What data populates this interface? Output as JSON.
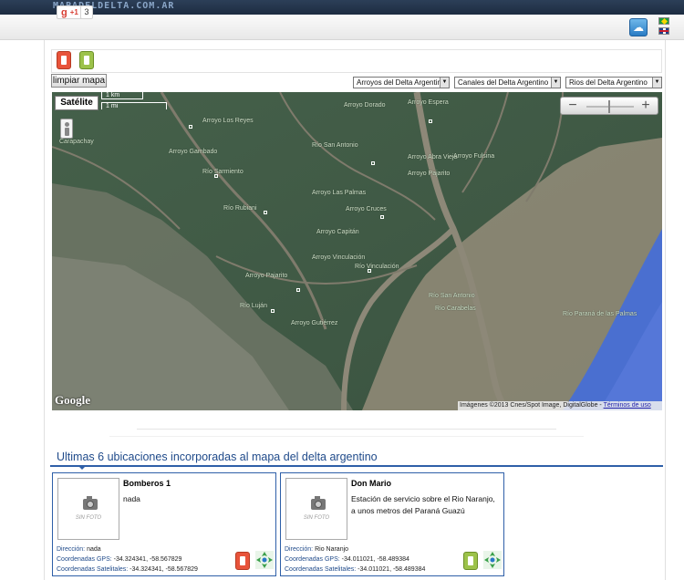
{
  "site": {
    "logo_text": "MAPADELDELTA.COM.AR"
  },
  "social": {
    "gplus_label": "+1",
    "gplus_g": "g",
    "gplus_count": "3"
  },
  "controls": {
    "clear_button": "limpiar mapa"
  },
  "filters": [
    {
      "label": "Arroyos del Delta Argentino"
    },
    {
      "label": "Canales del Delta Argentino"
    },
    {
      "label": "Rios del Delta Argentino"
    }
  ],
  "map": {
    "type_button": "Satélite",
    "scale_km": "1 km",
    "scale_mi": "1 mi",
    "zoom_out": "−",
    "zoom_in": "+",
    "google_logo": "Google",
    "copyright": "Imágenes ©2013 Cnes/Spot Image, DigitalGlobe -",
    "terms": "Términos de uso",
    "places": [
      {
        "name": "Carapachay"
      },
      {
        "name": "Arroyo Dorado"
      },
      {
        "name": "Arroyo Espera"
      },
      {
        "name": "Arroyo Los Reyes"
      },
      {
        "name": "Arroyo Abra Vieja"
      },
      {
        "name": "Arroyo Gambado"
      },
      {
        "name": "Río San Antonio"
      },
      {
        "name": "Arroyo Pajarito"
      },
      {
        "name": "Río Sarmiento"
      },
      {
        "name": "Arroyo Las Palmas"
      },
      {
        "name": "Arroyo Fulsina"
      },
      {
        "name": "Río Rubiani"
      },
      {
        "name": "Arroyo Cruces"
      },
      {
        "name": "Arroyo Capitán"
      },
      {
        "name": "Arroyo Vinculación"
      },
      {
        "name": "Río Vinculación"
      },
      {
        "name": "Río Luján"
      },
      {
        "name": "Río San Antonio"
      },
      {
        "name": "Arroyo Gutiérrez"
      },
      {
        "name": "Río Carabelas"
      },
      {
        "name": "Arroyo Pajarito"
      },
      {
        "name": "Río Paraná de las Palmas"
      }
    ]
  },
  "latest": {
    "heading": "Ultimas 6 ubicaciones incorporadas al mapa del delta argentino",
    "photo_placeholder": "SIN FOTO",
    "labels": {
      "address": "Dirección:",
      "gps": "Coordenadas GPS:",
      "sat": "Coordenadas Satelitales:"
    },
    "items": [
      {
        "title": "Bomberos 1",
        "description": "nada",
        "address": "nada",
        "gps": "-34.324341, -58.567829",
        "sat": "-34.324341, -58.567829",
        "category_icon": "fire-station-icon",
        "category_color": "#e8533a"
      },
      {
        "title": "Don Mario",
        "description": "Estación de servicio sobre el Rio Naranjo, a unos metros del Paraná Guazú",
        "address": "Rio Naranjo",
        "gps": "-34.011021, -58.489384",
        "sat": "-34.011021, -58.489384",
        "category_icon": "gas-station-icon",
        "category_color": "#9cc24a"
      }
    ]
  },
  "colors": {
    "accent": "#2e5fa8",
    "heading": "#1f4a8a",
    "water": "#4a6fd0",
    "land": "#3f5a45"
  }
}
